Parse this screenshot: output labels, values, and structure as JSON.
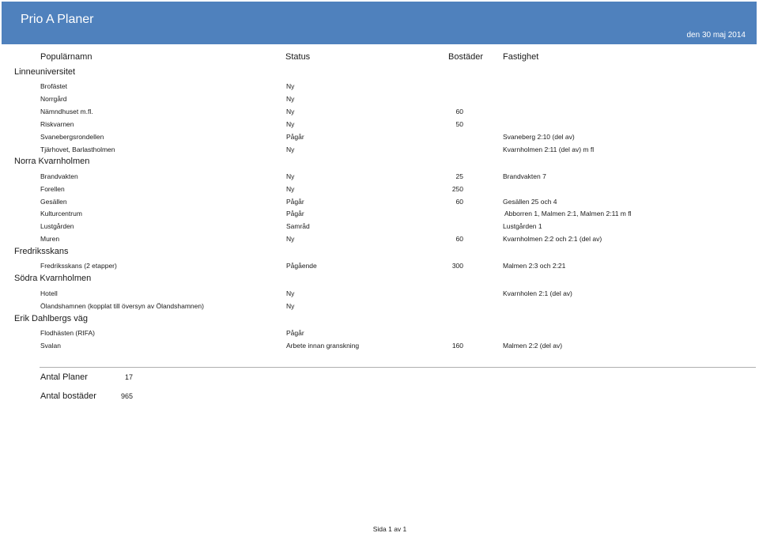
{
  "header": {
    "title": "Prio A Planer",
    "date": "den 30 maj 2014",
    "color": "#4f81bd"
  },
  "columns": {
    "name": "Populärnamn",
    "status": "Status",
    "bostader": "Bostäder",
    "fastighet": "Fastighet"
  },
  "groups": [
    {
      "name": "Linneuniversitet",
      "rows": [
        {
          "name": "Brofästet",
          "status": "Ny",
          "bostader": "",
          "fastighet": ""
        },
        {
          "name": "Norrgård",
          "status": "Ny",
          "bostader": "",
          "fastighet": ""
        },
        {
          "name": "Nämndhuset m.fl.",
          "status": "Ny",
          "bostader": "60",
          "fastighet": ""
        },
        {
          "name": "Riskvarnen",
          "status": "Ny",
          "bostader": "50",
          "fastighet": ""
        },
        {
          "name": "Svanebergsrondellen",
          "status": "Pågår",
          "bostader": "",
          "fastighet": "Svaneberg 2:10 (del av)"
        },
        {
          "name": "Tjärhovet, Barlastholmen",
          "status": "Ny",
          "bostader": "",
          "fastighet": "Kvarnholmen 2:11 (del av) m fl"
        }
      ]
    },
    {
      "name": "Norra Kvarnholmen",
      "rows": [
        {
          "name": "Brandvakten",
          "status": "Ny",
          "bostader": "25",
          "fastighet": "Brandvakten 7"
        },
        {
          "name": "Forellen",
          "status": "Ny",
          "bostader": "250",
          "fastighet": ""
        },
        {
          "name": "Gesällen",
          "status": "Pågår",
          "bostader": "60",
          "fastighet": "Gesällen 25 och 4"
        },
        {
          "name": "Kulturcentrum",
          "status": "Pågår",
          "bostader": "",
          "fastighet": "Abborren 1, Malmen 2:1, Malmen 2:11 m fl"
        },
        {
          "name": "Lustgården",
          "status": "Samråd",
          "bostader": "",
          "fastighet": "Lustgården 1"
        },
        {
          "name": "Muren",
          "status": "Ny",
          "bostader": "60",
          "fastighet": "Kvarnholmen 2:2 och 2:1 (del av)"
        }
      ]
    },
    {
      "name": "Fredriksskans",
      "rows": [
        {
          "name": "Fredriksskans (2 etapper)",
          "status": "Pågående",
          "bostader": "300",
          "fastighet": "Malmen 2:3 och 2:21"
        }
      ]
    },
    {
      "name": "Södra Kvarnholmen",
      "rows": [
        {
          "name": "Hotell",
          "status": "Ny",
          "bostader": "",
          "fastighet": "Kvarnholen 2:1 (del av)"
        },
        {
          "name": "Ölandshamnen (kopplat till översyn av Ölandshamnen)",
          "status": "Ny",
          "bostader": "",
          "fastighet": ""
        }
      ]
    },
    {
      "name": "Erik Dahlbergs väg",
      "rows": [
        {
          "name": "Flodhästen (RIFA)",
          "status": "Pågår",
          "bostader": "",
          "fastighet": ""
        },
        {
          "name": "Svalan",
          "status": "Arbete innan granskning",
          "bostader": "160",
          "fastighet": "Malmen 2:2 (del av)"
        }
      ]
    }
  ],
  "summary": {
    "antal_planer_label": "Antal Planer",
    "antal_planer": "17",
    "antal_bostader_label": "Antal bostäder",
    "antal_bostader": "965"
  },
  "footer": "Sida 1 av 1"
}
